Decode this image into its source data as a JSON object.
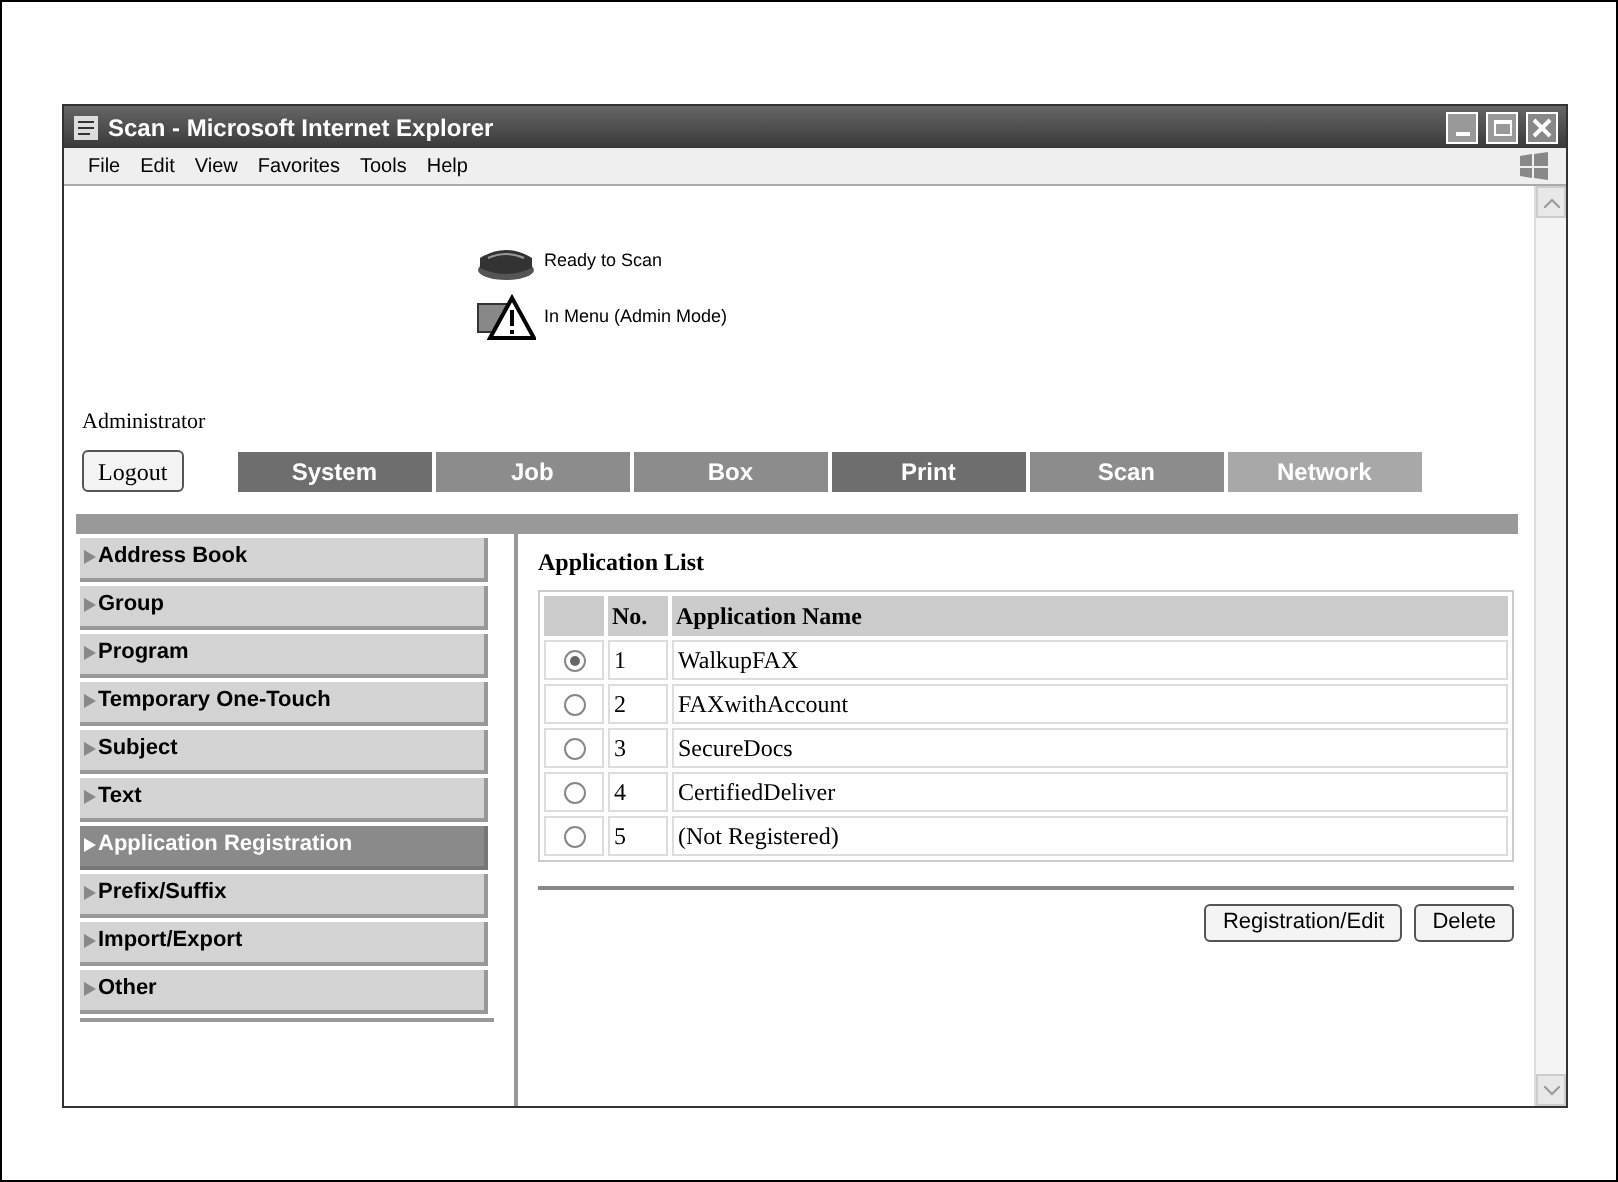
{
  "window": {
    "title": "Scan - Microsoft Internet Explorer"
  },
  "menu": [
    "File",
    "Edit",
    "View",
    "Favorites",
    "Tools",
    "Help"
  ],
  "status": [
    {
      "kind": "printer",
      "text": "Ready to Scan"
    },
    {
      "kind": "warning",
      "text": "In Menu (Admin Mode)"
    }
  ],
  "user": "Administrator",
  "logout_button": "Logout",
  "tabs": [
    {
      "label": "System",
      "color": "#6e6e6e"
    },
    {
      "label": "Job",
      "color": "#8c8c8c"
    },
    {
      "label": "Box",
      "color": "#8c8c8c"
    },
    {
      "label": "Print",
      "color": "#6e6e6e"
    },
    {
      "label": "Scan",
      "color": "#8c8c8c"
    },
    {
      "label": "Network",
      "color": "#a8a8a8"
    }
  ],
  "sidebar": {
    "items": [
      {
        "label": "Address Book",
        "selected": false
      },
      {
        "label": "Group",
        "selected": false
      },
      {
        "label": "Program",
        "selected": false
      },
      {
        "label": "Temporary One-Touch",
        "selected": false
      },
      {
        "label": "Subject",
        "selected": false
      },
      {
        "label": "Text",
        "selected": false
      },
      {
        "label": "Application Registration",
        "selected": true
      },
      {
        "label": "Prefix/Suffix",
        "selected": false
      },
      {
        "label": "Import/Export",
        "selected": false
      },
      {
        "label": "Other",
        "selected": false
      }
    ]
  },
  "main": {
    "heading": "Application List",
    "table": {
      "columns": [
        "No.",
        "Application Name"
      ],
      "rows": [
        {
          "selected": true,
          "no": "1",
          "name": "WalkupFAX"
        },
        {
          "selected": false,
          "no": "2",
          "name": "FAXwithAccount"
        },
        {
          "selected": false,
          "no": "3",
          "name": "SecureDocs"
        },
        {
          "selected": false,
          "no": "4",
          "name": "CertifiedDeliver"
        },
        {
          "selected": false,
          "no": "5",
          "name": "(Not Registered)"
        }
      ]
    },
    "buttons": [
      "Registration/Edit",
      "Delete"
    ]
  }
}
